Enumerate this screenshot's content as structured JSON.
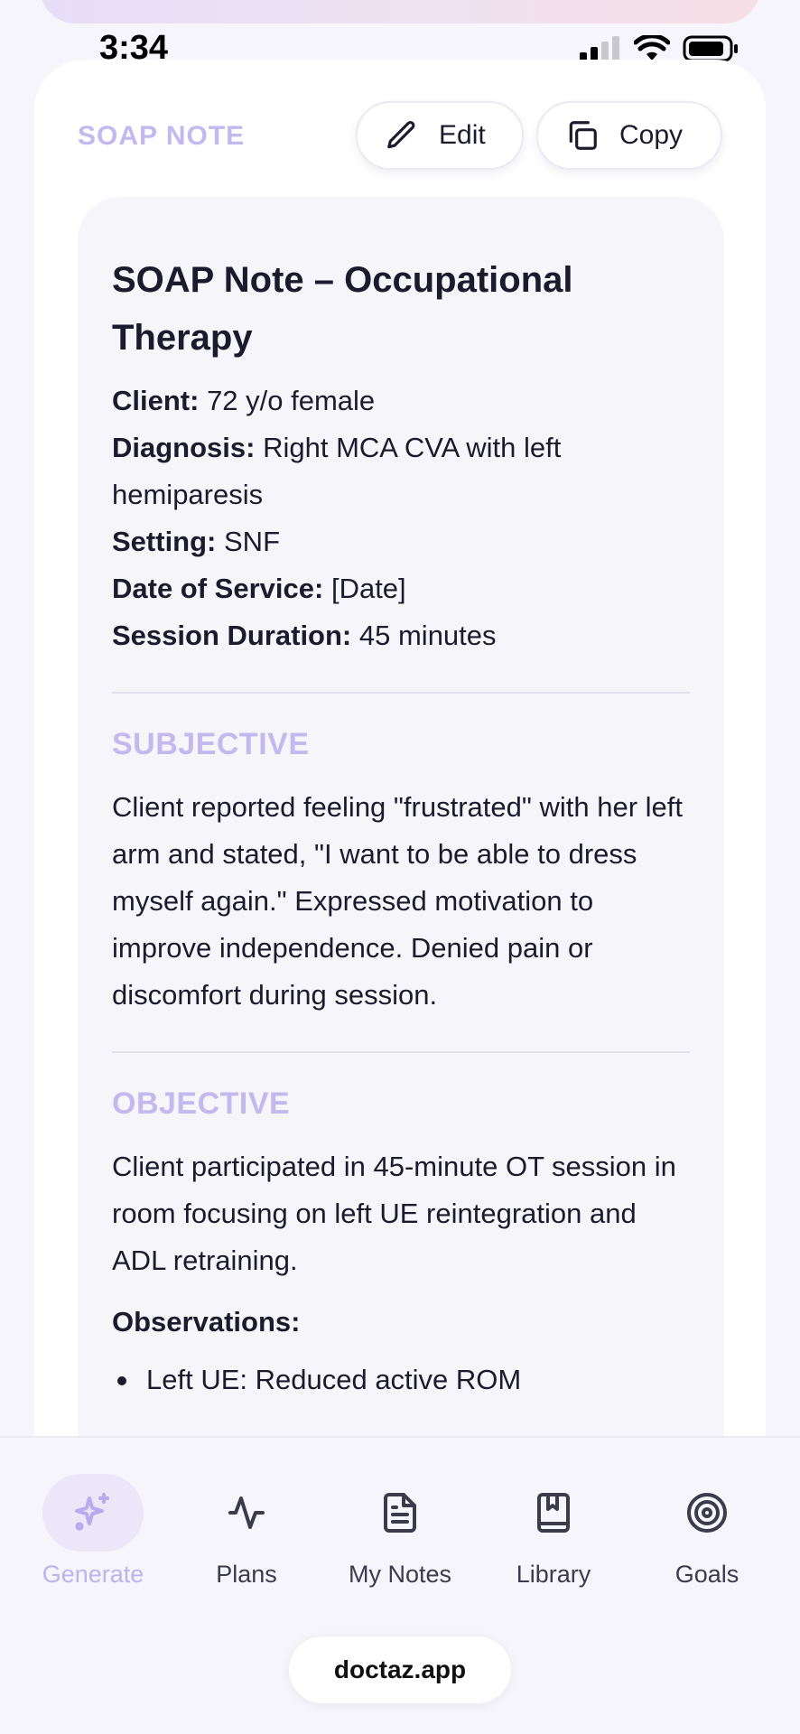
{
  "status_bar": {
    "time": "3:34"
  },
  "header": {
    "section_tag": "SOAP NOTE",
    "edit_label": "Edit",
    "copy_label": "Copy"
  },
  "document": {
    "title": "SOAP Note – Occupational Therapy",
    "meta": [
      {
        "label": "Client:",
        "value": "72 y/o female"
      },
      {
        "label": "Diagnosis:",
        "value": "Right MCA CVA with left hemiparesis"
      },
      {
        "label": "Setting:",
        "value": "SNF"
      },
      {
        "label": "Date of Service:",
        "value": "[Date]"
      },
      {
        "label": "Session Duration:",
        "value": "45 minutes"
      }
    ],
    "subjective": {
      "heading": "SUBJECTIVE",
      "text": "Client reported feeling \"frustrated\" with her left arm and stated, \"I want to be able to dress myself again.\" Expressed motivation to improve independence. Denied pain or discomfort during session."
    },
    "objective": {
      "heading": "OBJECTIVE",
      "text": "Client participated in 45-minute OT session in room focusing on left UE reintegration and ADL retraining.",
      "observations_heading": "Observations:",
      "bullets": [
        "Left UE: Reduced active ROM"
      ]
    }
  },
  "bottom_nav": {
    "items": [
      {
        "label": "Generate",
        "icon": "sparkle-icon",
        "active": true
      },
      {
        "label": "Plans",
        "icon": "activity-icon",
        "active": false
      },
      {
        "label": "My Notes",
        "icon": "document-icon",
        "active": false
      },
      {
        "label": "Library",
        "icon": "book-icon",
        "active": false
      },
      {
        "label": "Goals",
        "icon": "target-icon",
        "active": false
      }
    ]
  },
  "browser": {
    "url": "doctaz.app"
  },
  "colors": {
    "accent": "#c3b9ee",
    "text": "#1c1b2e",
    "background": "#f6f5fb",
    "card": "#ffffff"
  }
}
